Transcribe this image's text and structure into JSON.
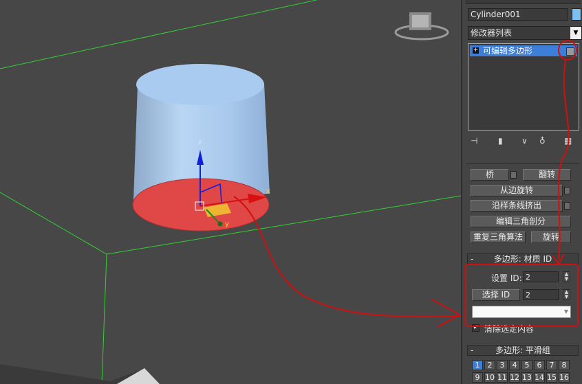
{
  "object_name": "Cylinder001",
  "object_color": "#7ec0f2",
  "modifier_list_label": "修改器列表",
  "modifier_stack": [
    {
      "label": "可编辑多边形",
      "selected": true
    }
  ],
  "stack_toolbar_icons": [
    "pin-stack-icon",
    "show-end-result-icon",
    "make-unique-icon",
    "remove-modifier-icon",
    "configure-modifier-sets-icon"
  ],
  "edit_geometry": {
    "bridge_label": "桥",
    "flip_label": "翻转",
    "hinge_from_edge_label": "从边旋转",
    "extrude_along_spline_label": "沿样条线挤出",
    "edit_triangulation_label": "编辑三角剖分",
    "retriangulate_label": "重复三角算法",
    "turn_label": "旋转"
  },
  "material_ids": {
    "title": "多边形: 材质 ID",
    "collapse_sign": "-",
    "set_id_label": "设置 ID:",
    "set_id_value": "2",
    "select_id_label": "选择 ID",
    "select_id_value": "2",
    "material_dropdown_value": "",
    "clear_selection_label": "清除选定内容",
    "clear_selection_checked": true,
    "check_mark": "✔"
  },
  "smoothing_groups": {
    "title": "多边形: 平滑组",
    "collapse_sign": "-",
    "row1": [
      "1",
      "2",
      "3",
      "4",
      "5",
      "6",
      "7",
      "8"
    ],
    "row2": [
      "9",
      "10",
      "11",
      "12",
      "13",
      "14",
      "15",
      "16"
    ],
    "active": [
      "1"
    ]
  },
  "viewport": {
    "axis_x": "x",
    "axis_y": "y",
    "axis_z": "z",
    "viewcube": "viewcube-icon"
  },
  "annotation_color": "#d01010",
  "accent_color": "#3d7ed8"
}
